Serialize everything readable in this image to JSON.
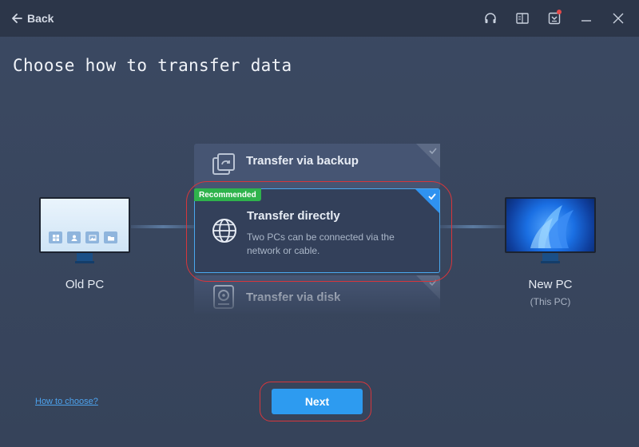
{
  "titlebar": {
    "back_label": "Back",
    "icons": [
      "headset-icon",
      "book-icon",
      "download-icon",
      "minimize-icon",
      "close-icon"
    ]
  },
  "page_title": "Choose how to transfer data",
  "old_pc": {
    "label": "Old PC"
  },
  "new_pc": {
    "label": "New PC",
    "sublabel": "(This PC)"
  },
  "options": {
    "backup": {
      "title": "Transfer via backup"
    },
    "direct": {
      "badge": "Recommended",
      "title": "Transfer directly",
      "description": "Two PCs can be connected via the network or cable.",
      "selected": true
    },
    "disk": {
      "title": "Transfer via disk"
    }
  },
  "footer": {
    "help_link": "How to choose?",
    "next_label": "Next"
  },
  "colors": {
    "accent": "#2d9bf0",
    "badge": "#2fb34c",
    "highlight_ring": "#d7363b",
    "titlebar": "#2c3649"
  }
}
